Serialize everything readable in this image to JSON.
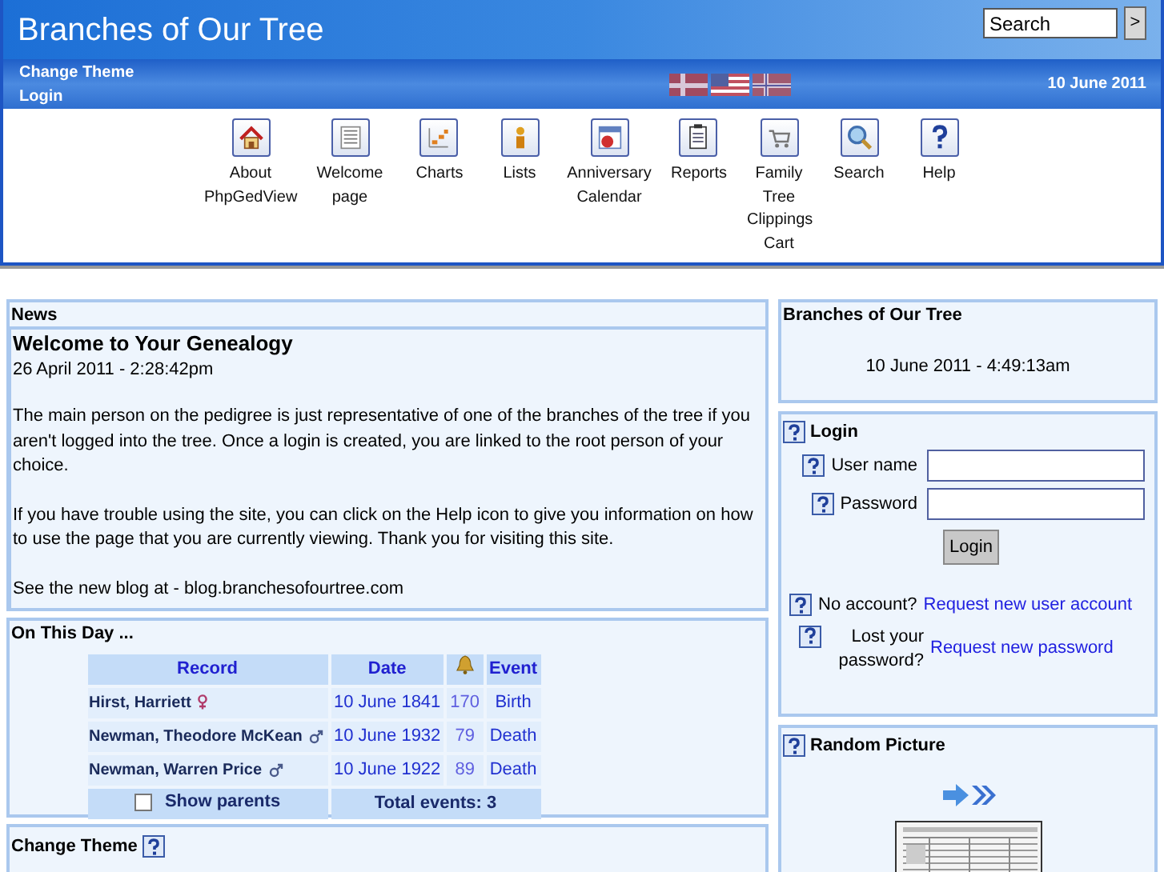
{
  "header": {
    "title": "Branches of Our Tree",
    "search": {
      "value": "Search"
    },
    "search_button": ">",
    "links": [
      "Change Theme",
      "Login"
    ],
    "date": "10 June 2011"
  },
  "menu": [
    {
      "label": "About PhpGedView"
    },
    {
      "label": "Welcome page"
    },
    {
      "label": "Charts"
    },
    {
      "label": "Lists"
    },
    {
      "label": "Anniversary Calendar"
    },
    {
      "label": "Reports"
    },
    {
      "label": "Family Tree Clippings Cart"
    },
    {
      "label": "Search"
    },
    {
      "label": "Help"
    }
  ],
  "news": {
    "title": "News",
    "heading": "Welcome to Your Genealogy",
    "date": "26 April 2011 - 2:28:42pm",
    "paragraphs": [
      "The main person on the pedigree is just representative of one of the branches of the tree if you aren't logged into the tree. Once a login is created, you are linked to the root person of your choice.",
      "If you have trouble using the site, you can click on the Help icon to give you information on how to use the page that you are currently viewing. Thank you for visiting this site.",
      "See the new blog at - blog.branchesofourtree.com"
    ]
  },
  "on_this_day": {
    "title": "On This Day ...",
    "columns": [
      "Record",
      "Date",
      "Event"
    ],
    "rows": [
      {
        "record": "Hirst, Harriett",
        "kind": "female",
        "date": "10 June 1841",
        "years": "170",
        "event": "Birth"
      },
      {
        "record": "Newman, Theodore McKean",
        "kind": "male",
        "date": "10 June 1932",
        "years": "79",
        "event": "Death"
      },
      {
        "record": "Newman, Warren Price",
        "kind": "male",
        "date": "10 June 1922",
        "years": "89",
        "event": "Death"
      }
    ],
    "show_parents": {
      "label": "Show parents",
      "checked": false
    },
    "total": "Total events: 3"
  },
  "change_theme": {
    "title": "Change Theme"
  },
  "site_block": {
    "title": "Branches of Our Tree",
    "datetime": "10 June 2011 - 4:49:13am"
  },
  "login": {
    "title": "Login",
    "username_label": "User name",
    "password_label": "Password",
    "button": "Login",
    "no_account": "No account?",
    "request_account": "Request new user account",
    "lost_password": "Lost your password?",
    "request_password": "Request new password"
  },
  "random_picture": {
    "title": "Random Picture"
  }
}
